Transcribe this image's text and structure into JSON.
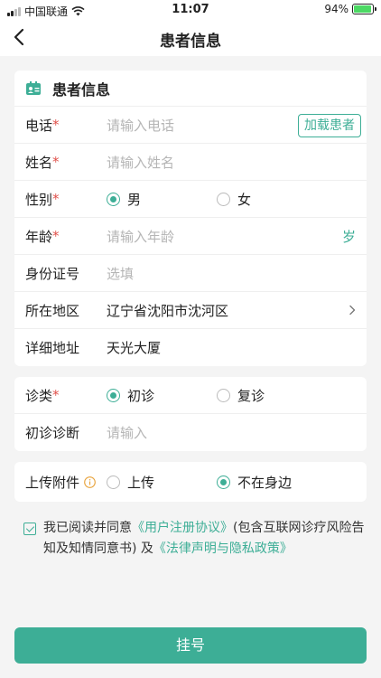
{
  "status_bar": {
    "carrier": "中国联通",
    "time": "11:07",
    "battery": "94%",
    "battery_level": 0.94
  },
  "nav": {
    "title": "患者信息"
  },
  "patient_card": {
    "title": "患者信息",
    "phone": {
      "label": "电话",
      "required": "*",
      "placeholder": "请输入电话",
      "action": "加载患者"
    },
    "name": {
      "label": "姓名",
      "required": "*",
      "placeholder": "请输入姓名"
    },
    "gender": {
      "label": "性别",
      "required": "*",
      "options": [
        "男",
        "女"
      ],
      "selected": "男"
    },
    "age": {
      "label": "年龄",
      "required": "*",
      "placeholder": "请输入年龄",
      "unit": "岁"
    },
    "id_card": {
      "label": "身份证号",
      "placeholder": "选填"
    },
    "region": {
      "label": "所在地区",
      "value": "辽宁省沈阳市沈河区"
    },
    "address": {
      "label": "详细地址",
      "value": "天光大厦"
    }
  },
  "visit_card": {
    "type": {
      "label": "诊类",
      "required": "*",
      "options": [
        "初诊",
        "复诊"
      ],
      "selected": "初诊"
    },
    "diagnosis": {
      "label": "初诊诊断",
      "placeholder": "请输入"
    }
  },
  "attach_card": {
    "label": "上传附件",
    "options": [
      "上传",
      "不在身边"
    ],
    "selected": "不在身边"
  },
  "agreement": {
    "checked": true,
    "text1": "我已阅读并同意",
    "link1": "《用户注册协议》",
    "text2": "(包含互联网诊疗风险告知及知情同意书) 及",
    "link2": "《法律声明与隐私政策》"
  },
  "submit": {
    "label": "挂号"
  },
  "colors": {
    "accent": "#3dae96",
    "required": "#e0504a"
  }
}
